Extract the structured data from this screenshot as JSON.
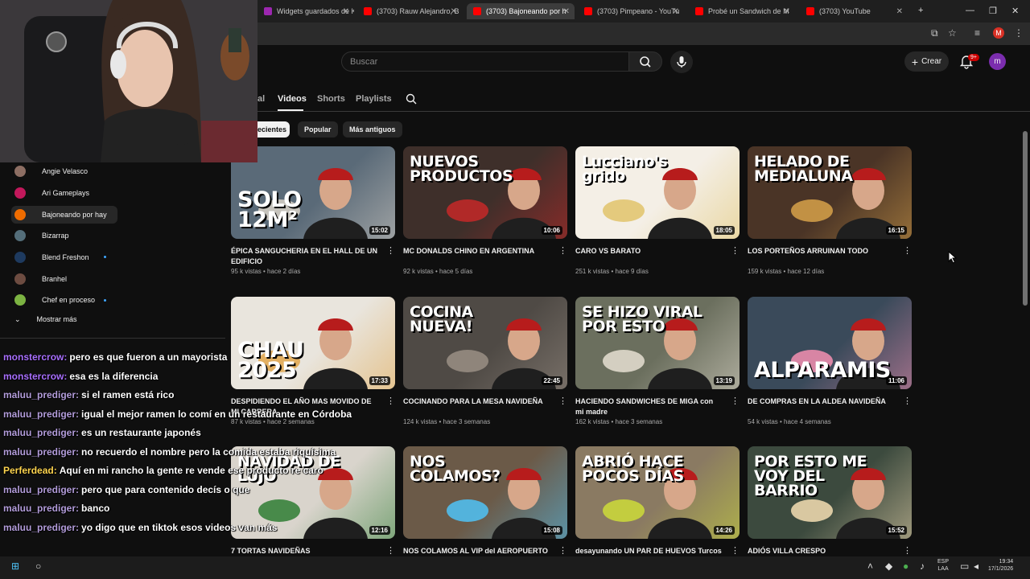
{
  "browser": {
    "tabs": [
      {
        "title": "Widgets guardados de Ki",
        "favicon_color": "#9c27b0",
        "active": false
      },
      {
        "title": "(3703) Rauw Alejandro, B",
        "favicon_color": "#ff0000",
        "active": false
      },
      {
        "title": "(3703) Bajoneando por h",
        "favicon_color": "#ff0000",
        "active": true
      },
      {
        "title": "(3703) Pimpeano - YouTu",
        "favicon_color": "#ff0000",
        "active": false
      },
      {
        "title": "Probé un Sandwich de M",
        "favicon_color": "#ff0000",
        "active": false
      },
      {
        "title": "(3703) YouTube",
        "favicon_color": "#ff0000",
        "active": false
      }
    ],
    "profile_initial": "M"
  },
  "youtube": {
    "search_placeholder": "Buscar",
    "create_label": "Crear",
    "notifications_badge": "9+",
    "avatar_initial": "m"
  },
  "channel": {
    "tabs": [
      "al",
      "Videos",
      "Shorts",
      "Playlists"
    ],
    "active_tab": "Videos",
    "chips": [
      "ecientes",
      "Popular",
      "Más antiguos"
    ],
    "active_chip": "ecientes"
  },
  "sidebar": {
    "subscriptions": [
      {
        "name": "Angie Velasco",
        "color": "#8d6e63",
        "new": false
      },
      {
        "name": "Ari Gameplays",
        "color": "#c2185b",
        "new": false
      },
      {
        "name": "Bajoneando por hay",
        "color": "#ef6c00",
        "new": false,
        "active": true
      },
      {
        "name": "Bizarrap",
        "color": "#546e7a",
        "new": false
      },
      {
        "name": "Blend Freshon",
        "color": "#1e3a5f",
        "new": true
      },
      {
        "name": "Branhel",
        "color": "#6d4c41",
        "new": false
      },
      {
        "name": "Chef en proceso",
        "color": "#7cb342",
        "new": true
      }
    ],
    "show_more": "Mostrar más"
  },
  "videos": [
    {
      "title": "ÉPICA SANGUCHERIA EN EL HALL DE UN EDIFICIO",
      "meta": "95 k vistas • hace 2 días",
      "duration": "15:02",
      "thumb_text": "SOLO 12M²",
      "bg": "#5a6a78",
      "accent": "#d9d2c8"
    },
    {
      "title": "MC DONALDS CHINO EN ARGENTINA",
      "meta": "92 k vistas • hace 5 días",
      "duration": "10:06",
      "thumb_text": "NUEVOS PRODUCTOS",
      "bg": "#3e2f2a",
      "accent": "#c62828"
    },
    {
      "title": "CARO VS BARATO",
      "meta": "251 k vistas • hace 9 días",
      "duration": "18:05",
      "thumb_text": "Lucciano's  grido",
      "bg": "#f4efe6",
      "accent": "#e1c36a"
    },
    {
      "title": "LOS PORTEÑOS ARRUINAN TODO",
      "meta": "159 k vistas • hace 12 días",
      "duration": "16:15",
      "thumb_text": "HELADO DE MEDIALUNA",
      "bg": "#4a3426",
      "accent": "#d7a24a"
    },
    {
      "title": "DESPIDIENDO EL AÑO MAS MOVIDO DE MI CARRERA",
      "meta": "87 k vistas • hace 2 semanas",
      "duration": "17:33",
      "thumb_text": "CHAU 2025",
      "bg": "#e9e5dd",
      "accent": "#e0a64b"
    },
    {
      "title": "COCINANDO PARA LA MESA NAVIDEÑA",
      "meta": "124 k vistas • hace 3 semanas",
      "duration": "22:45",
      "thumb_text": "COCINA NUEVA!",
      "bg": "#4f4a45",
      "accent": "#9a8f85"
    },
    {
      "title": "HACIENDO SANDWICHES DE MIGA con mi madre",
      "meta": "162 k vistas • hace 3 semanas",
      "duration": "13:19",
      "thumb_text": "SE HIZO VIRAL POR ESTO",
      "bg": "#6b6f5e",
      "accent": "#e6e0d2"
    },
    {
      "title": "DE COMPRAS EN LA ALDEA NAVIDEÑA",
      "meta": "54 k vistas • hace 4 semanas",
      "duration": "11:06",
      "thumb_text": "ALPARAMIS",
      "bg": "#3a4a5a",
      "accent": "#f48fb1"
    },
    {
      "title": "7 TORTAS NAVIDEÑAS",
      "meta": "",
      "duration": "12:16",
      "thumb_text": "NAVIDAD DE LUJO",
      "bg": "#d9d4cc",
      "accent": "#2e7d32"
    },
    {
      "title": "NOS COLAMOS AL VIP del AEROPUERTO DE",
      "meta": "",
      "duration": "15:08",
      "thumb_text": "NOS COLAMOS?",
      "bg": "#6b5a48",
      "accent": "#4fc3f7"
    },
    {
      "title": "desayunando UN PAR DE HUEVOS Turcos",
      "meta": "",
      "duration": "14:26",
      "thumb_text": "ABRIÓ HACE POCOS DÍAS",
      "bg": "#8a7a62",
      "accent": "#cddc39"
    },
    {
      "title": "ADIÓS VILLA CRESPO",
      "meta": "",
      "duration": "15:52",
      "thumb_text": "POR ESTO ME VOY DEL BARRIO",
      "bg": "#3c4a3e",
      "accent": "#f5deb3"
    }
  ],
  "chat": [
    {
      "user": "monstercrow:",
      "color": "#a970ff",
      "text": "pero es que fueron a un mayorista"
    },
    {
      "user": "monstercrow:",
      "color": "#a970ff",
      "text": "esa es la diferencia"
    },
    {
      "user": "maluu_prediger:",
      "color": "#b39ddb",
      "text": "si el ramen está rico"
    },
    {
      "user": "maluu_prediger:",
      "color": "#b39ddb",
      "text": "igual el mejor ramen lo comí en un restaurante en Córdoba"
    },
    {
      "user": "maluu_prediger:",
      "color": "#b39ddb",
      "text": "es un restaurante japonés"
    },
    {
      "user": "maluu_prediger:",
      "color": "#b39ddb",
      "text": "no recuerdo el nombre pero la comida estaba riquísima"
    },
    {
      "user": "Perferdead:",
      "color": "#ffd54f",
      "text": "Aquí en mi rancho la gente re vende ese producto re caro"
    },
    {
      "user": "maluu_prediger:",
      "color": "#b39ddb",
      "text": "pero que para contenido decís o que"
    },
    {
      "user": "maluu_prediger:",
      "color": "#b39ddb",
      "text": "banco"
    },
    {
      "user": "maluu_prediger:",
      "color": "#b39ddb",
      "text": "yo digo que en tiktok esos videos van más"
    }
  ],
  "taskbar": {
    "lang_top": "ESP",
    "lang_bottom": "LAA",
    "time": "19:34",
    "date": "17/1/2026"
  }
}
